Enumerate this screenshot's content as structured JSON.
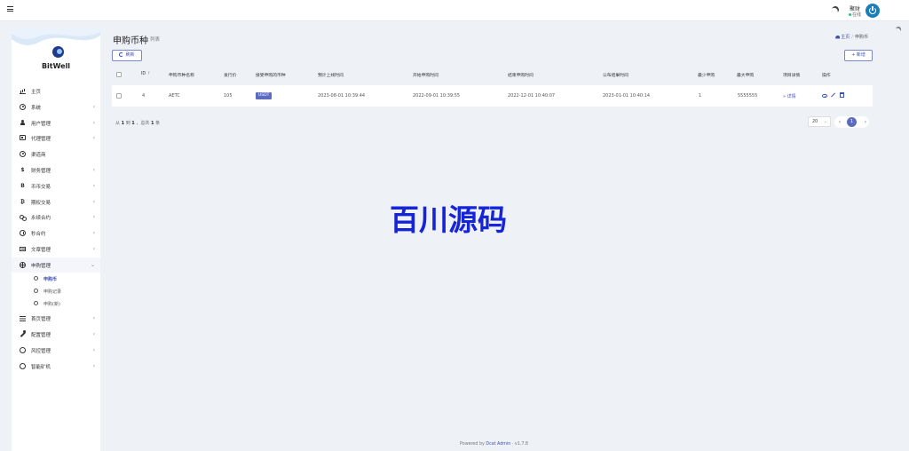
{
  "topbar": {
    "user_name": "聚财",
    "user_status": "在线"
  },
  "sidebar": {
    "brand": "BitWell",
    "menu": [
      {
        "label": "主页",
        "icon": "bar-chart-icon",
        "chevron": false
      },
      {
        "label": "系统",
        "icon": "gear-icon",
        "chevron": true
      },
      {
        "label": "用户管理",
        "icon": "user-icon",
        "chevron": true
      },
      {
        "label": "代理管理",
        "icon": "id-card-icon",
        "chevron": true
      },
      {
        "label": "渠道商",
        "icon": "user-circle-icon",
        "chevron": false
      },
      {
        "label": "财务管理",
        "icon": "dollar-icon",
        "chevron": true
      },
      {
        "label": "币币交易",
        "icon": "bitcoin-icon",
        "chevron": true
      },
      {
        "label": "期权交易",
        "icon": "bitcoin-circle-icon",
        "chevron": true
      },
      {
        "label": "永续合约",
        "icon": "link-icon",
        "chevron": true
      },
      {
        "label": "秒合约",
        "icon": "clock-icon",
        "chevron": true
      },
      {
        "label": "文章管理",
        "icon": "document-icon",
        "chevron": true
      },
      {
        "label": "申购管理",
        "icon": "crosshair-icon",
        "chevron": "open"
      }
    ],
    "submenu": [
      {
        "label": "申购币",
        "active": true
      },
      {
        "label": "申购记录",
        "active": false
      },
      {
        "label": "申购(新)",
        "active": false
      }
    ],
    "menu_after": [
      {
        "label": "首页管理",
        "icon": "list-icon",
        "chevron": true
      },
      {
        "label": "配置管理",
        "icon": "wrench-icon",
        "chevron": true
      },
      {
        "label": "风控管理",
        "icon": "circle-icon",
        "chevron": true
      },
      {
        "label": "智能矿机",
        "icon": "circle-icon",
        "chevron": true
      }
    ]
  },
  "page": {
    "title": "申购币种",
    "subtitle": "列表",
    "breadcrumb": [
      "主页",
      "申购币"
    ],
    "refresh_label": "刷新",
    "add_label": "+ 新增"
  },
  "table": {
    "columns": [
      "ID",
      "申购币种名称",
      "发行价",
      "接受申购的币种",
      "预计上线时间",
      "开始申购时间",
      "结束申购时间",
      "公布结果时间",
      "最少申购",
      "最大申购",
      "项目详情",
      "操作"
    ],
    "sort_glyph": "↑",
    "rows": [
      {
        "id": "4",
        "name": "AETC",
        "price": "105",
        "accept_coin": "USDT",
        "listing_time": "2023-08-01 10:39:44",
        "start_time": "2022-09-01 10:39:55",
        "end_time": "2022-12-01 10:40:07",
        "result_time": "2023-01-01 10:40:14",
        "min": "1",
        "max": "5555555",
        "detail_label": "» 详情"
      }
    ]
  },
  "pagination": {
    "info_prefix": "从",
    "from": "1",
    "info_to": "到",
    "to": "1",
    "info_total": "，总共",
    "total": "1",
    "info_suffix": "条",
    "page_size": "20",
    "current_page": "1"
  },
  "watermark": "百川源码",
  "footer": {
    "powered": "Powered by",
    "brand": "Dcat Admin",
    "version": "· v1.7.8"
  },
  "colors": {
    "accent": "#3f51b5",
    "badge": "#5c6bc0",
    "watermark": "#1424d6",
    "background": "#eef1f6"
  }
}
